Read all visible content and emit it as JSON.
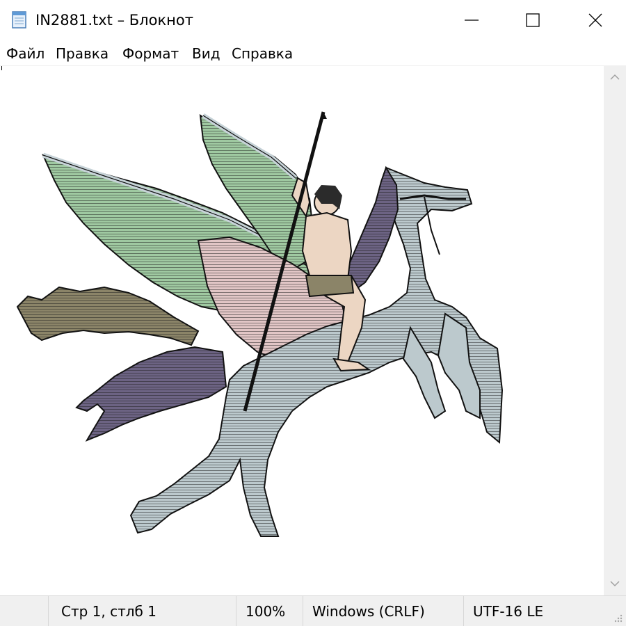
{
  "window": {
    "title": "IN2881.txt – Блокнот",
    "icons": {
      "app": "notepad-icon",
      "minimize": "minimize-icon",
      "maximize": "maximize-icon",
      "close": "close-icon"
    }
  },
  "menu": {
    "items": [
      "Файл",
      "Правка",
      "Формат",
      "Вид",
      "Справка"
    ]
  },
  "editor": {
    "content_description_icon": "pegasus-ascii-art",
    "colors": {
      "wing_green": "#9fc9a1",
      "feather_pink": "#e2c6c6",
      "horse_blue": "#bcc9cd",
      "cloak_olive": "#8b8468",
      "skin": "#ecd6c3",
      "mane_purple": "#6c6383"
    }
  },
  "status": {
    "position": "Стр 1, стлб 1",
    "zoom": "100%",
    "line_ending": "Windows (CRLF)",
    "encoding": "UTF-16 LE"
  },
  "scrollbar": {
    "icons": {
      "up": "chevron-up-icon",
      "down": "chevron-down-icon"
    }
  }
}
